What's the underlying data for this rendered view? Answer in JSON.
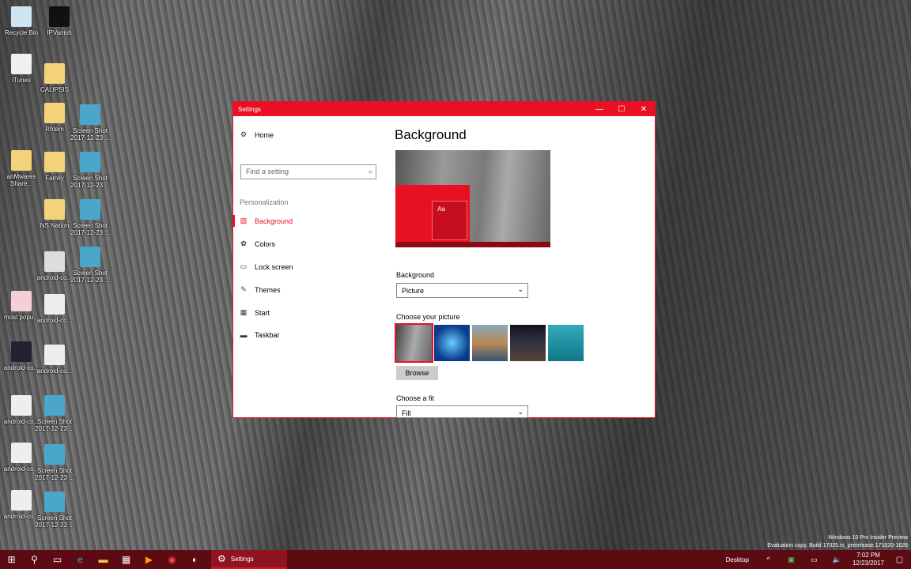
{
  "desktop_icons": [
    {
      "label": "Recycle Bin",
      "color": "#cfe3f0"
    },
    {
      "label": "IPVanish",
      "color": "#111"
    },
    {
      "label": "iTunes",
      "color": "#f0f0f0"
    },
    {
      "label": "CALIPSIS",
      "color": "#f3d27a"
    },
    {
      "label": "Rhtem",
      "color": "#f3d27a"
    },
    {
      "label": "Screen Shot 2017-12-23 ...",
      "color": "#4aa7c9"
    },
    {
      "label": "anMwares Share...",
      "color": "#f3d27a"
    },
    {
      "label": "Family",
      "color": "#f3d27a"
    },
    {
      "label": "Screen Shot 2017-12-23 ...",
      "color": "#4aa7c9"
    },
    {
      "label": "NS Nation",
      "color": "#f3d27a"
    },
    {
      "label": "Screen Shot 2017-12-23 ...",
      "color": "#4aa7c9"
    },
    {
      "label": "android-co...",
      "color": "#ddd"
    },
    {
      "label": "Screen Shot 2017-12-23 ...",
      "color": "#4aa7c9"
    },
    {
      "label": "most popu...",
      "color": "#f4d0d6"
    },
    {
      "label": "android-co...",
      "color": "#eee"
    },
    {
      "label": "android-co...",
      "color": "#223"
    },
    {
      "label": "android-co...",
      "color": "#eee"
    },
    {
      "label": "android-co...",
      "color": "#eee"
    },
    {
      "label": "Screen Shot 2017-12-23 ...",
      "color": "#4aa7c9"
    },
    {
      "label": "android-co...",
      "color": "#eee"
    },
    {
      "label": "Screen Shot 2017-12-23 ...",
      "color": "#4aa7c9"
    },
    {
      "label": "android-co...",
      "color": "#eee"
    },
    {
      "label": "Screen Shot 2017-12-23 ...",
      "color": "#4aa7c9"
    }
  ],
  "window": {
    "title": "Settings",
    "accent": "#e81123",
    "minimize": "—",
    "maximize": "☐",
    "close": "✕"
  },
  "sidebar": {
    "home": "Home",
    "search_placeholder": "Find a setting",
    "section": "Personalization",
    "items": [
      {
        "label": "Background",
        "icon": "picture-icon"
      },
      {
        "label": "Colors",
        "icon": "palette-icon"
      },
      {
        "label": "Lock screen",
        "icon": "lock-screen-icon"
      },
      {
        "label": "Themes",
        "icon": "themes-icon"
      },
      {
        "label": "Start",
        "icon": "start-icon"
      },
      {
        "label": "Taskbar",
        "icon": "taskbar-icon"
      }
    ],
    "selected": "Background"
  },
  "main": {
    "title": "Background",
    "preview_sample": "Aa",
    "background_label": "Background",
    "background_value": "Picture",
    "choose_picture_label": "Choose your picture",
    "browse": "Browse",
    "fit_label": "Choose a fit",
    "fit_value": "Fill"
  },
  "taskbar": {
    "active_app": "Settings",
    "desktop": "Desktop",
    "time": "7:02 PM",
    "date": "12/23/2017"
  },
  "watermark": {
    "line1": "Windows 10 Pro Insider Preview",
    "line2": "Evaluation copy. Build 17025.rs_prerelease.171020-1626"
  }
}
